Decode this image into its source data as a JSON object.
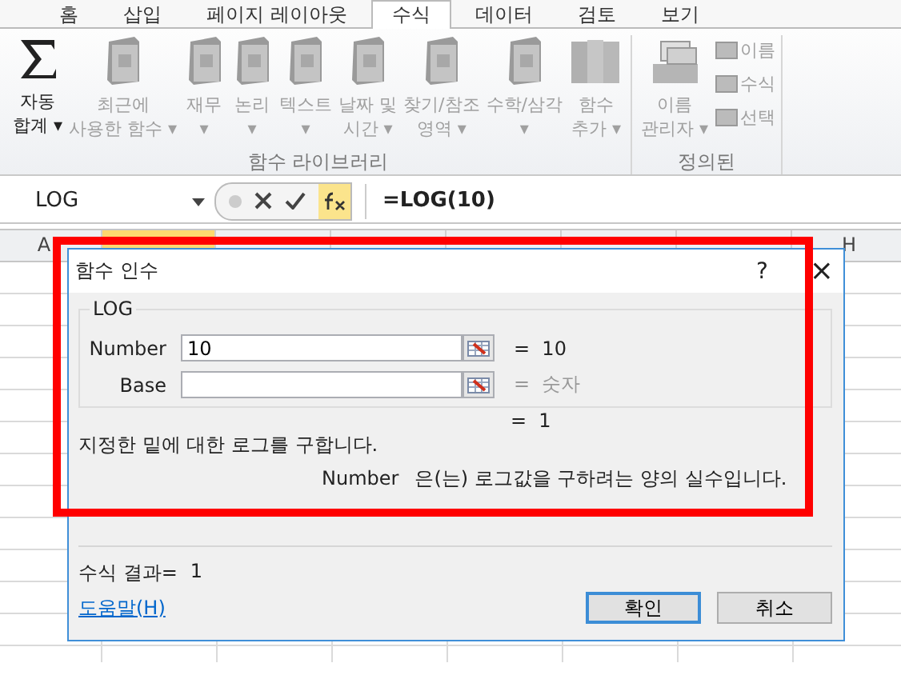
{
  "ribbon_tabs": [
    {
      "label": "홈",
      "selected": false
    },
    {
      "label": "삽입",
      "selected": false
    },
    {
      "label": "페이지 레이아웃",
      "selected": false
    },
    {
      "label": "수식",
      "selected": true
    },
    {
      "label": "데이터",
      "selected": false
    },
    {
      "label": "검토",
      "selected": false
    },
    {
      "label": "보기",
      "selected": false
    }
  ],
  "ribbon": {
    "groups": [
      {
        "label": "함수 라이브러리",
        "buttons": [
          {
            "kind": "sigma",
            "lines": [
              "자동",
              "합계 ▾"
            ],
            "disabled": false
          },
          {
            "kind": "book",
            "lines": [
              "최근에",
              "사용한 함수 ▾"
            ],
            "disabled": true
          },
          {
            "kind": "book",
            "lines": [
              "재무",
              "▾"
            ],
            "disabled": true
          },
          {
            "kind": "book",
            "lines": [
              "논리",
              "▾"
            ],
            "disabled": true
          },
          {
            "kind": "book",
            "lines": [
              "텍스트",
              "▾"
            ],
            "disabled": true
          },
          {
            "kind": "book",
            "lines": [
              "날짜 및",
              "시간 ▾"
            ],
            "disabled": true
          },
          {
            "kind": "book",
            "lines": [
              "찾기/참조",
              "영역 ▾"
            ],
            "disabled": true
          },
          {
            "kind": "book",
            "lines": [
              "수학/삼각",
              "▾"
            ],
            "disabled": true
          },
          {
            "kind": "books",
            "lines": [
              "함수",
              "추가 ▾"
            ],
            "disabled": true
          }
        ]
      },
      {
        "label": "정의된",
        "buttons": [
          {
            "kind": "cards",
            "lines": [
              "이름",
              "관리자 ▾"
            ],
            "disabled": true
          }
        ],
        "small_buttons": [
          {
            "label": "이름",
            "disabled": true
          },
          {
            "label": "수식",
            "disabled": true
          },
          {
            "label": "선택",
            "disabled": true
          }
        ]
      }
    ]
  },
  "formula_bar": {
    "name_box": "LOG",
    "formula": "=LOG(10)"
  },
  "sheet": {
    "columns": [
      {
        "label": "A",
        "selected": false
      },
      {
        "selected": true
      },
      {
        "selected": false
      },
      {
        "selected": false
      },
      {
        "selected": false
      },
      {
        "selected": false
      },
      {
        "selected": false
      },
      {
        "label": "H",
        "selected": false
      }
    ]
  },
  "dialog": {
    "title": "함수 인수",
    "help": "?",
    "close": "×",
    "function_name": "LOG",
    "arguments": [
      {
        "name": "Number",
        "value": "10",
        "result": "= 10",
        "dimmed": false
      },
      {
        "name": "Base",
        "result": "= 숫자",
        "dimmed": true
      }
    ],
    "result": "= 1",
    "description": "지정한 밑에 대한 로그를 구합니다.",
    "argument_help": {
      "name": "Number",
      "text": "은(는) 로그값을 구하려는 양의 실수입니다."
    },
    "formula_result_label": "수식 결과=",
    "formula_result": "1",
    "help_link": "도움말(H)",
    "buttons": [
      {
        "label": "확인",
        "default": true
      },
      {
        "label": "취소",
        "default": false
      }
    ]
  },
  "annotation": {
    "shown": true
  }
}
